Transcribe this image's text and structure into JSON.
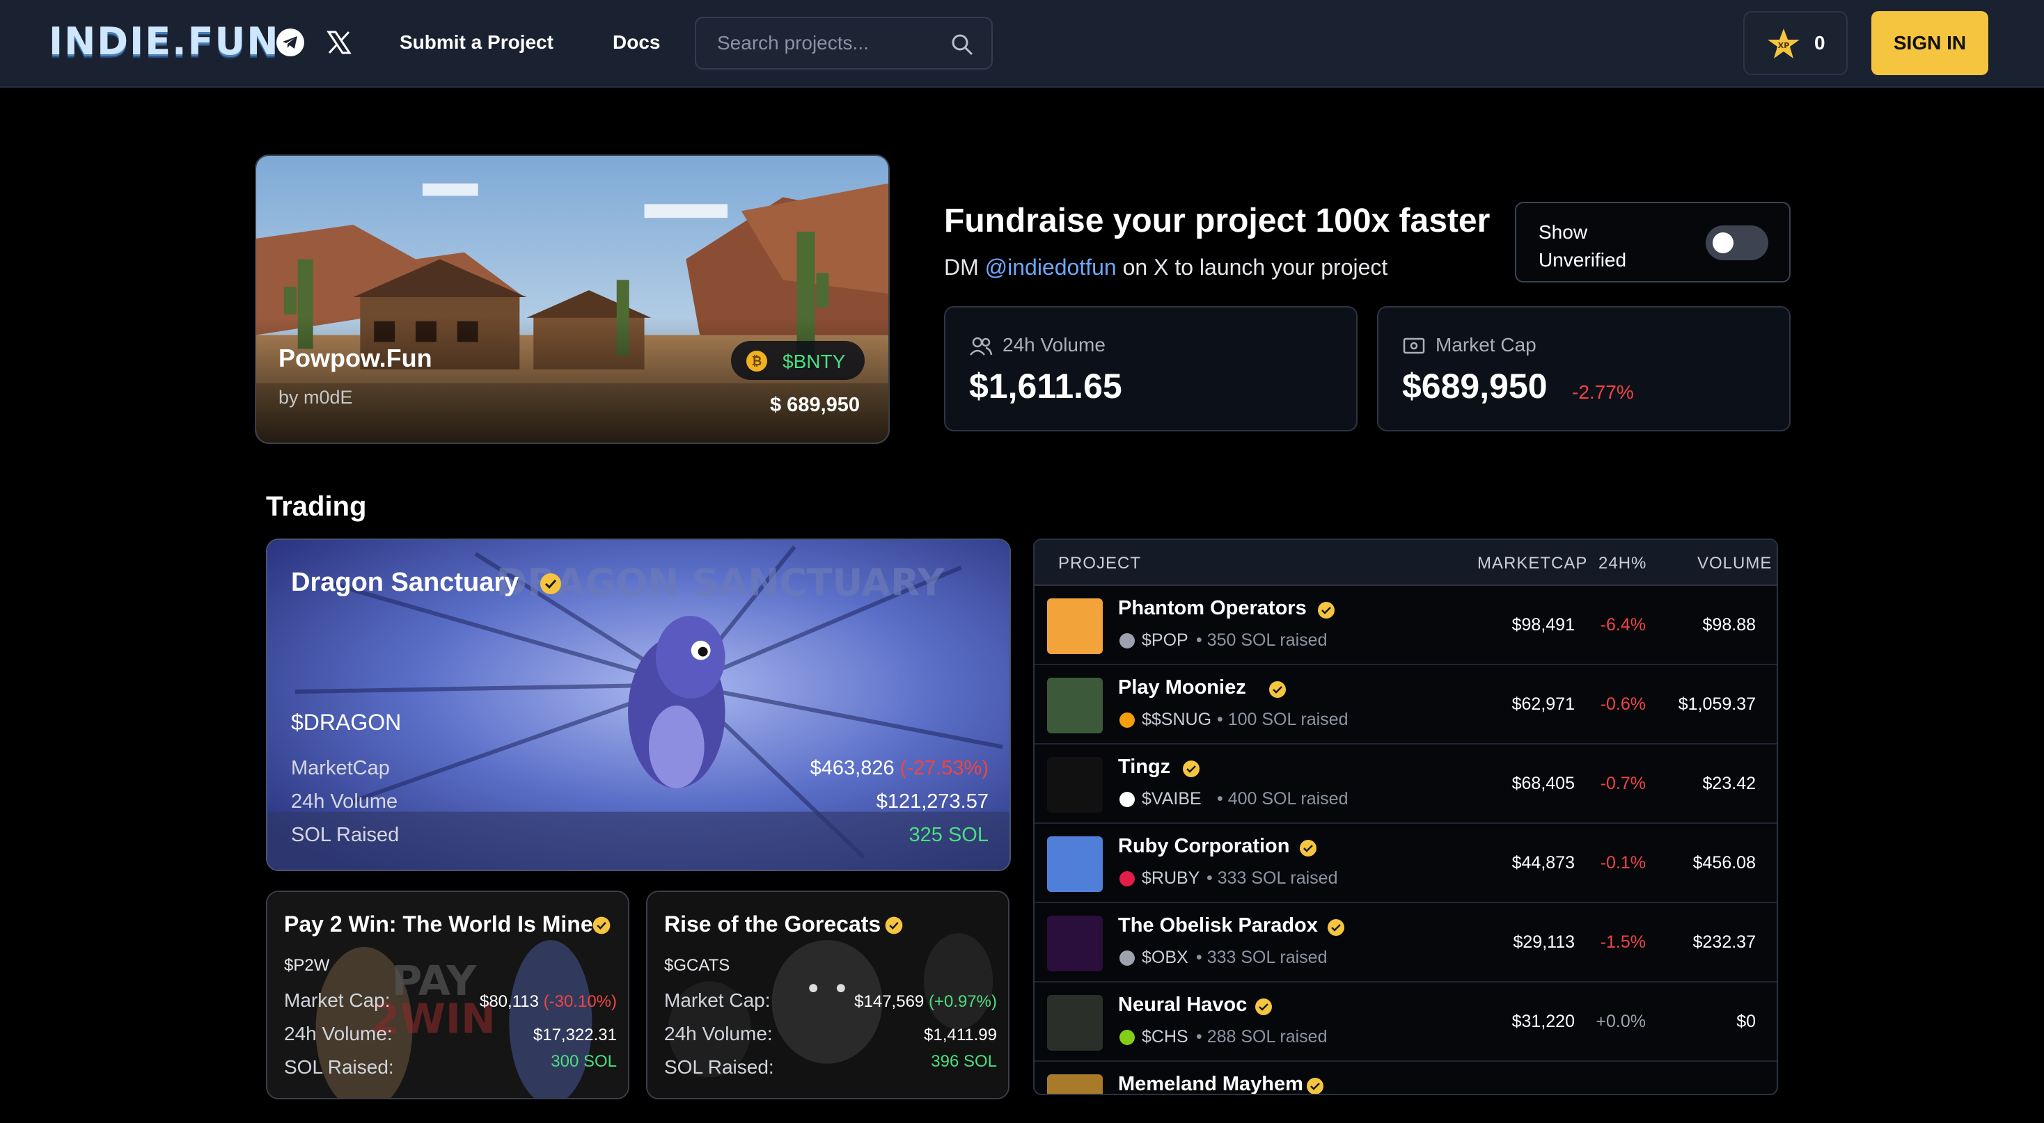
{
  "nav": {
    "logo": "INDIE.FUN",
    "submit_label": "Submit a Project",
    "docs_label": "Docs",
    "search_placeholder": "Search projects...",
    "xp_count": "0",
    "signin_label": "SIGN IN"
  },
  "hero": {
    "title": "Powpow.Fun",
    "author": "by m0dE",
    "ticker": "$BNTY",
    "market_cap": "$ 689,950"
  },
  "fundraise": {
    "title": "Fundraise your project 100x faster",
    "sub_prefix": "DM",
    "handle": "@indiedotfun",
    "sub_suffix": "on X to launch your project",
    "toggle_label_1": "Show",
    "toggle_label_2": "Unverified",
    "toggle_on": false
  },
  "stats": {
    "volume_label": "24h Volume",
    "volume_value": "$1,611.65",
    "mc_label": "Market Cap",
    "mc_value": "$689,950",
    "mc_delta": "-2.77%"
  },
  "trading": {
    "heading": "Trading",
    "featured": {
      "name": "Dragon Sanctuary",
      "ticker": "$DRAGON",
      "mc_label": "MarketCap",
      "mc_value": "$463,826",
      "mc_delta": "(-27.53%)",
      "vol_label": "24h Volume",
      "vol_value": "$121,273.57",
      "raised_label": "SOL Raised",
      "raised_value": "325 SOL"
    },
    "cards": [
      {
        "name": "Pay 2 Win: The World Is Mine",
        "ticker": "$P2W",
        "mc_label": "Market Cap:",
        "mc_value": "$80,113",
        "mc_delta": "(-30.10%)",
        "vol_label": "24h Volume:",
        "vol_value": "$17,322.31",
        "raised_label": "SOL Raised:",
        "raised_value": "300 SOL"
      },
      {
        "name": "Rise of the Gorecats",
        "ticker": "$GCATS",
        "mc_label": "Market Cap:",
        "mc_value": "$147,569",
        "mc_delta": "(+0.97%)",
        "vol_label": "24h Volume:",
        "vol_value": "$1,411.99",
        "raised_label": "SOL Raised:",
        "raised_value": "396 SOL"
      }
    ]
  },
  "table": {
    "headers": {
      "project": "PROJECT",
      "marketcap": "MARKETCAP",
      "change": "24H%",
      "volume": "VOLUME"
    },
    "rows": [
      {
        "name": "Phantom Operators",
        "ticker": "$POP",
        "raised": "• 350 SOL raised",
        "mc": "$98,491",
        "chg": "-6.4%",
        "vol": "$98.88",
        "tick_color": "#9ca3af",
        "thumb_color": "#f2a33a"
      },
      {
        "name": "Play Mooniez",
        "ticker": "$$SNUG",
        "raised": "• 100 SOL raised",
        "mc": "$62,971",
        "chg": "-0.6%",
        "vol": "$1,059.37",
        "tick_color": "#f59e0b",
        "thumb_color": "#3c5a3a"
      },
      {
        "name": "Tingz",
        "ticker": "$VAIBE",
        "raised": "• 400 SOL raised",
        "mc": "$68,405",
        "chg": "-0.7%",
        "vol": "$23.42",
        "tick_color": "#ffffff",
        "thumb_color": "#111111"
      },
      {
        "name": "Ruby Corporation",
        "ticker": "$RUBY",
        "raised": "• 333 SOL raised",
        "mc": "$44,873",
        "chg": "-0.1%",
        "vol": "$456.08",
        "tick_color": "#e11d48",
        "thumb_color": "#4f7fd8"
      },
      {
        "name": "The Obelisk Paradox",
        "ticker": "$OBX",
        "raised": "• 333 SOL raised",
        "mc": "$29,113",
        "chg": "-1.5%",
        "vol": "$232.37",
        "tick_color": "#9ca3af",
        "thumb_color": "#2a0f3d"
      },
      {
        "name": "Neural Havoc",
        "ticker": "$CHS",
        "raised": "• 288 SOL raised",
        "mc": "$31,220",
        "chg": "+0.0%",
        "vol": "$0",
        "tick_color": "#84cc16",
        "thumb_color": "#2a2f2a"
      },
      {
        "name": "Memeland Mayhem",
        "ticker": "",
        "raised": "",
        "mc": "",
        "chg": "",
        "vol": "",
        "tick_color": "#9ca3af",
        "thumb_color": "#a87a2a"
      }
    ]
  }
}
